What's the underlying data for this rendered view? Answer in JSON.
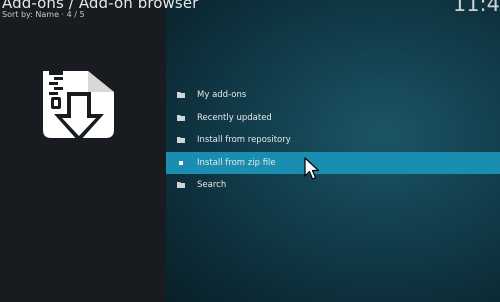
{
  "header": {
    "title": "Add-ons  / Add-on browser",
    "sort_info": "Sort by: Name  ·  4 / 5",
    "clock": "11:4"
  },
  "menu": {
    "items": [
      {
        "label": "My add-ons",
        "icon": "folder-icon"
      },
      {
        "label": "Recently updated",
        "icon": "folder-icon"
      },
      {
        "label": "Install from repository",
        "icon": "folder-icon"
      },
      {
        "label": "Install from zip file",
        "icon": "square-bullet-icon",
        "selected": true
      },
      {
        "label": "Search",
        "icon": "folder-icon"
      }
    ]
  },
  "preview": {
    "icon": "zip-download-icon"
  },
  "colors": {
    "selection": "#1a8eb0",
    "left_panel": "#181b20",
    "background": "#0d2a35"
  }
}
